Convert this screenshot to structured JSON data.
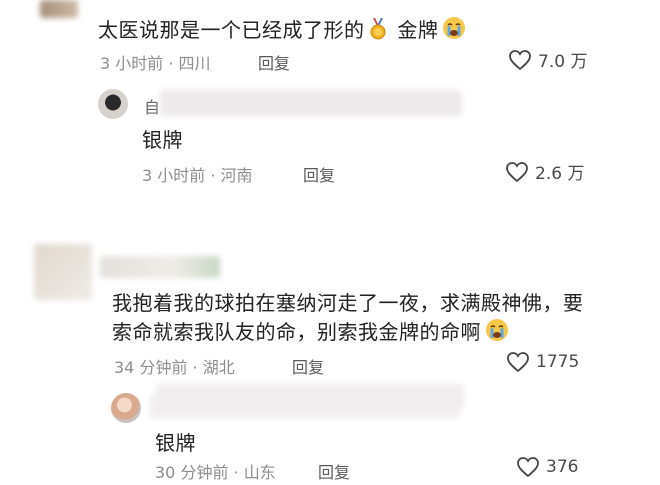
{
  "comments": [
    {
      "text": "太医说那是一个已经成了形的",
      "text_after": "金牌",
      "meta": "3 小时前 · 四川",
      "reply_label": "回复",
      "likes": "7.0 万",
      "reply": {
        "username_prefix": "自",
        "text": "银牌",
        "meta": "3 小时前 · 河南",
        "reply_label": "回复",
        "likes": "2.6 万"
      }
    },
    {
      "line1": "我抱着我的球拍在塞纳河走了一夜，求满殿神佛，要",
      "line2": "索命就索我队友的命，别索我金牌的命啊",
      "meta": "34 分钟前 · 湖北",
      "reply_label": "回复",
      "likes": "1775",
      "reply": {
        "text": "银牌",
        "meta": "30 分钟前 · 山东",
        "reply_label": "回复",
        "likes": "376"
      }
    }
  ],
  "icons": {
    "medal": "medal-icon",
    "crying_face": "crying-face-icon",
    "like": "heart-outline-icon"
  },
  "colors": {
    "text": "#222222",
    "meta": "#8e8e8e",
    "crying_face": "#f6c84a",
    "tear": "#5aa9e6"
  }
}
